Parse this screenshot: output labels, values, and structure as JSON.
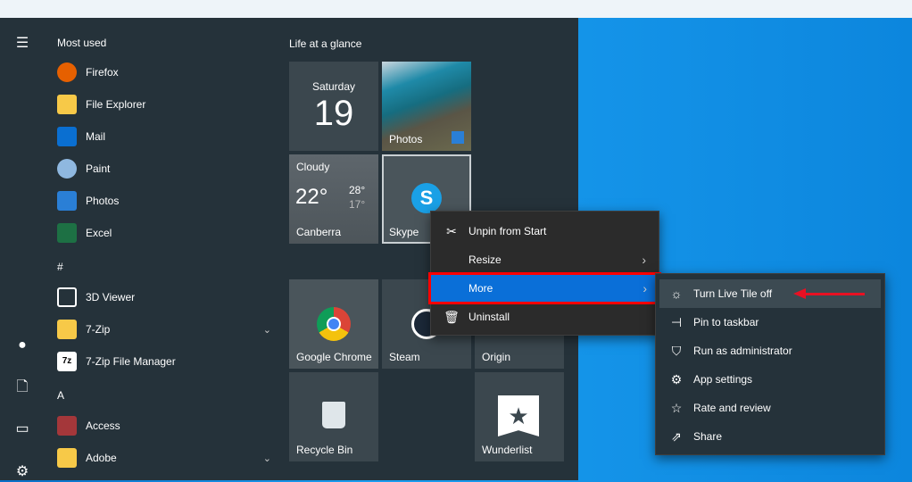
{
  "start": {
    "most_used_header": "Most used",
    "apps": [
      {
        "label": "Firefox",
        "icon": "firefox-icon",
        "color": "#e66000"
      },
      {
        "label": "File Explorer",
        "icon": "folder-icon",
        "color": "#f7c948"
      },
      {
        "label": "Mail",
        "icon": "mail-icon",
        "color": "#0a6fd1"
      },
      {
        "label": "Paint",
        "icon": "paint-icon",
        "color": "#8fb8e0"
      },
      {
        "label": "Photos",
        "icon": "photos-icon",
        "color": "#2a7fd6"
      },
      {
        "label": "Excel",
        "icon": "excel-icon",
        "color": "#1d7044"
      }
    ],
    "section_hash": "#",
    "hash_apps": [
      {
        "label": "3D Viewer",
        "icon": "cube-icon",
        "color": "#25323a"
      },
      {
        "label": "7-Zip",
        "icon": "folder-icon",
        "color": "#f7c948"
      },
      {
        "label": "7-Zip File Manager",
        "icon": "7zip-icon",
        "color": "#ffffff"
      }
    ],
    "section_a": "A",
    "a_apps": [
      {
        "label": "Access",
        "icon": "access-icon",
        "color": "#a4373a"
      },
      {
        "label": "Adobe",
        "icon": "folder-icon",
        "color": "#f7c948"
      }
    ]
  },
  "tiles": {
    "group_title": "Life at a glance",
    "calendar": {
      "day": "Saturday",
      "date": "19"
    },
    "photos": "Photos",
    "weather": {
      "condition": "Cloudy",
      "temp": "22°",
      "high": "28°",
      "low": "17°",
      "city": "Canberra"
    },
    "skype": "Skype",
    "chrome": "Google Chrome",
    "steam": "Steam",
    "origin": "Origin",
    "recycle": "Recycle Bin",
    "wunderlist": "Wunderlist"
  },
  "context_menu": {
    "items": [
      {
        "label": "Unpin from Start"
      },
      {
        "label": "Resize"
      },
      {
        "label": "More"
      },
      {
        "label": "Uninstall"
      }
    ]
  },
  "more_menu": {
    "items": [
      {
        "label": "Turn Live Tile off"
      },
      {
        "label": "Pin to taskbar"
      },
      {
        "label": "Run as administrator"
      },
      {
        "label": "App settings"
      },
      {
        "label": "Rate and review"
      },
      {
        "label": "Share"
      }
    ]
  },
  "colors": {
    "accent": "#0a6fd8",
    "highlight_border": "#ff0000"
  }
}
